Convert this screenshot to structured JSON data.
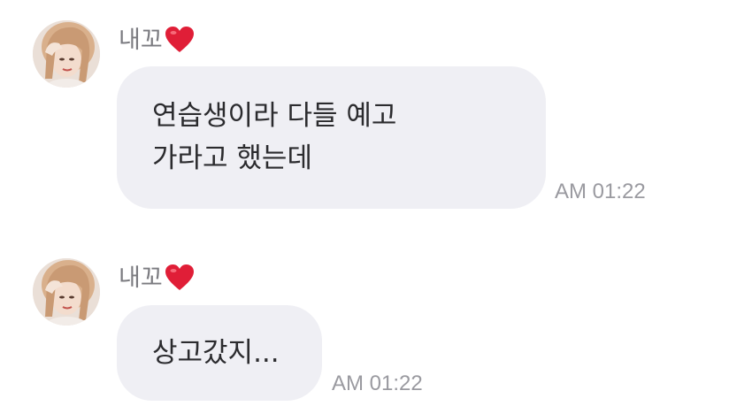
{
  "messages": [
    {
      "sender": "내꼬",
      "lines": [
        "연습생이라 다들 예고",
        "가라고 했는데"
      ],
      "time": "AM 01:22"
    },
    {
      "sender": "내꼬",
      "lines": [
        "상고갔지..."
      ],
      "time": "AM 01:22"
    }
  ],
  "colors": {
    "bubble": "#efeff4",
    "heart": "#e01e37",
    "sender": "#7b7b80",
    "time": "#9a9aa0"
  },
  "icons": {
    "heart": "heart-icon",
    "avatar": "avatar"
  }
}
